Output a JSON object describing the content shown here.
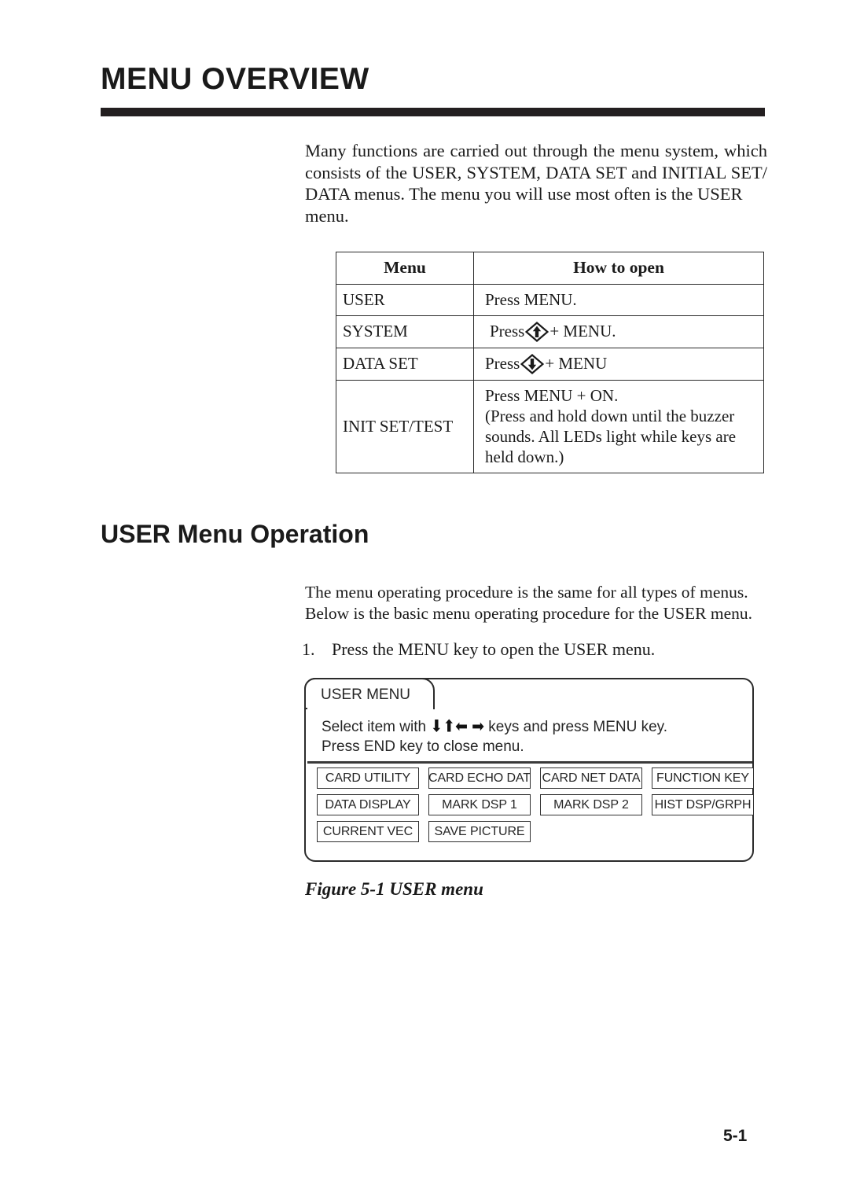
{
  "page": {
    "title": "MENU OVERVIEW",
    "number": "5-1"
  },
  "intro": {
    "line1": "Many functions are carried out through the menu system, which",
    "line2": "consists of the USER, SYSTEM, DATA SET and INITIAL SET/",
    "line3": "DATA menus. The menu you will use most often is the USER",
    "line4": "menu."
  },
  "table": {
    "headers": {
      "menu": "Menu",
      "how_to_open": "How to open"
    },
    "rows": [
      {
        "menu": "USER",
        "how_prefix": "Press MENU.",
        "icon": null,
        "how_suffix": ""
      },
      {
        "menu": "SYSTEM",
        "how_prefix": "Press",
        "icon": "key-up-arrow-icon",
        "how_suffix": "+ MENU."
      },
      {
        "menu": "DATA SET",
        "how_prefix": "Press",
        "icon": "key-down-arrow-icon",
        "how_suffix": "+ MENU"
      },
      {
        "menu": "INIT SET/TEST",
        "how_lines": [
          "Press MENU + ON.",
          "(Press and hold down until the buzzer",
          "sounds. All LEDs light while keys are",
          "held down.)"
        ]
      }
    ]
  },
  "section": {
    "heading": "USER Menu Operation",
    "paragraph": {
      "line1": "The menu operating procedure is the same for all types of menus.",
      "line2": "Below is the basic menu operating procedure for the USER menu."
    },
    "step_one": {
      "number": "1.",
      "text": "Press the MENU key to open the USER menu."
    }
  },
  "figure": {
    "caption": "Figure 5-1 USER menu",
    "tab_label": "USER MENU",
    "instruction_line1_part1": "Select item with",
    "instruction_arrows": [
      "⬇",
      "⬆",
      "⬅",
      "➡"
    ],
    "instruction_line1_part2": "keys and press MENU key.",
    "instruction_line2": "Press END key to close menu.",
    "menu_buttons": [
      [
        "CARD UTILITY",
        "CARD ECHO DAT",
        "CARD NET DATA",
        "FUNCTION KEY"
      ],
      [
        "DATA DISPLAY",
        "MARK DSP 1",
        "MARK DSP 2",
        "HIST DSP/GRPH"
      ],
      [
        "CURRENT VEC",
        "SAVE PICTURE",
        "",
        ""
      ]
    ]
  },
  "colors": {
    "ink": "#1a1a1a",
    "rule": "#231f20",
    "border": "#2b2b2b"
  }
}
